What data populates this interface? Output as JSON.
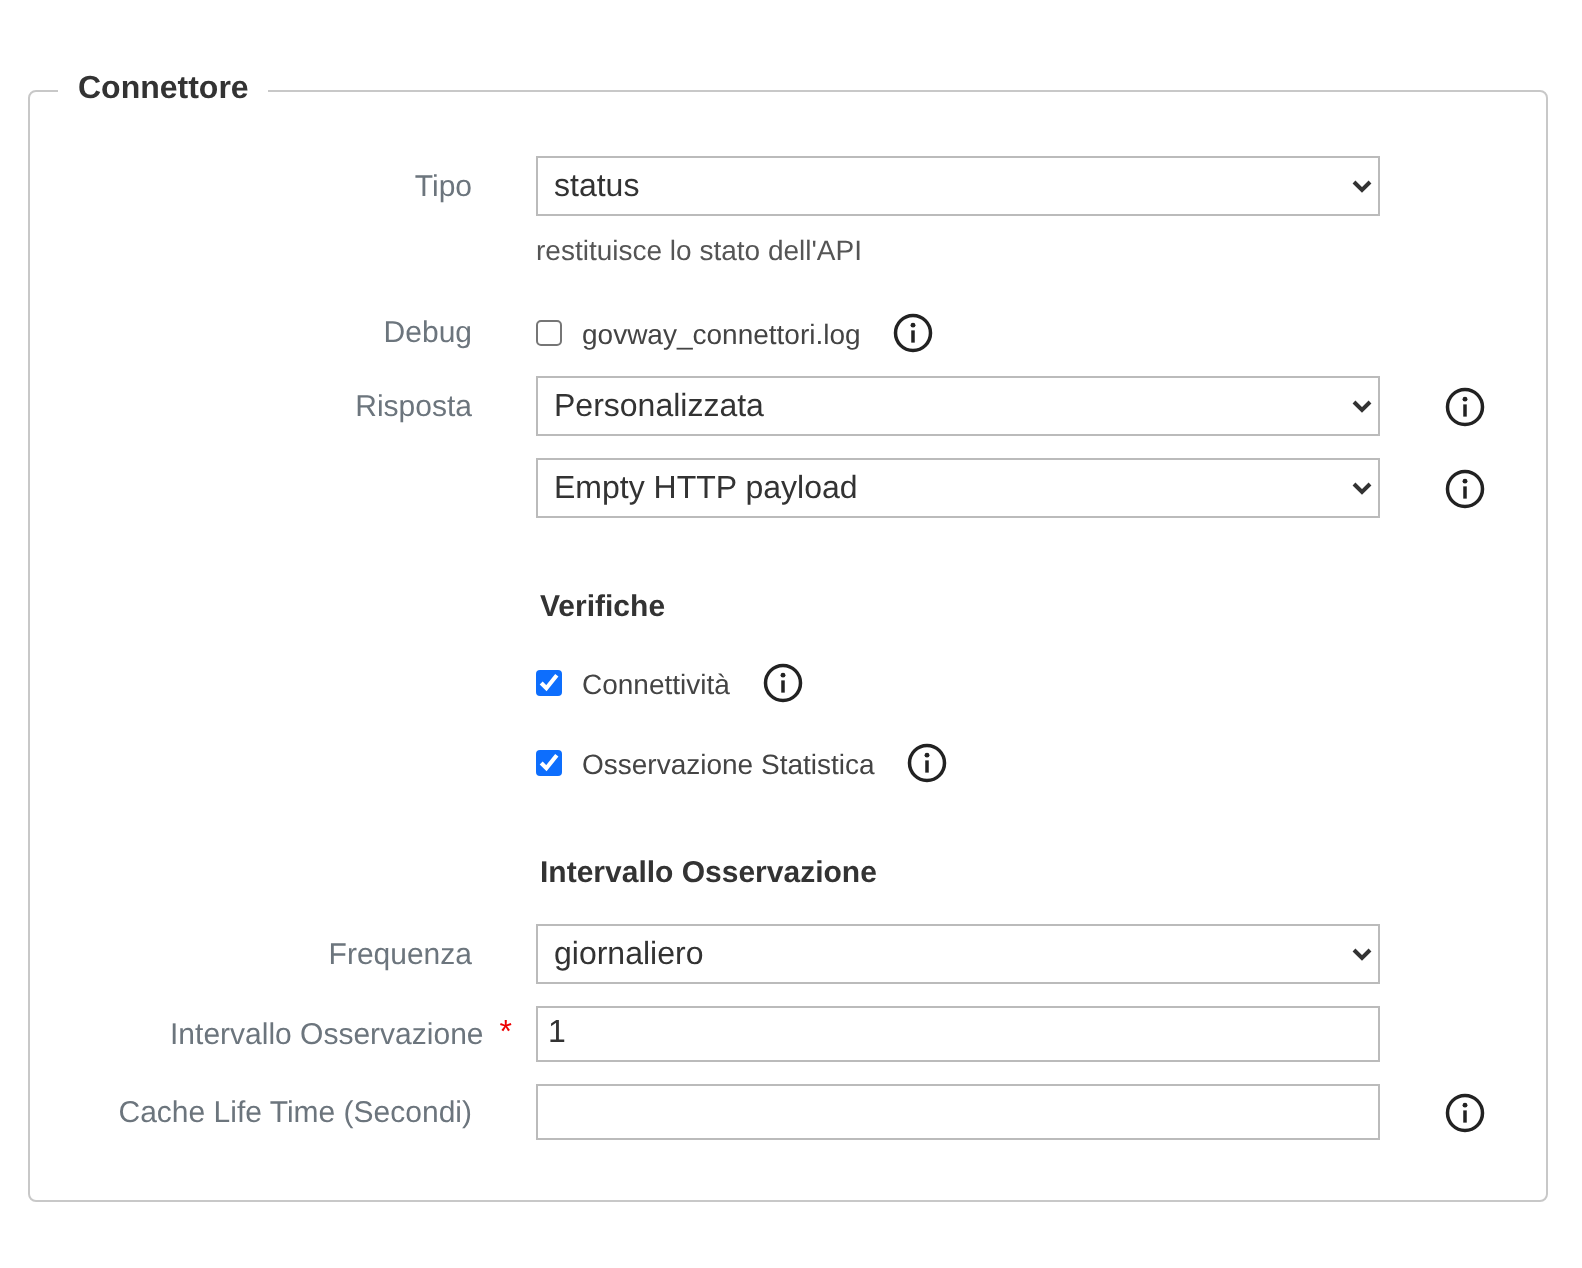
{
  "fieldset": {
    "legend": "Connettore",
    "rows": [
      {
        "kind": "select",
        "label": "Tipo",
        "value": "status",
        "hint": "restituisce lo stato dell'API",
        "info": false
      },
      {
        "kind": "checkbox",
        "label": "Debug",
        "text": "govway_connettori.log",
        "checked": false,
        "info": true
      },
      {
        "kind": "select",
        "label": "Risposta",
        "value": "Personalizzata",
        "info": true
      },
      {
        "kind": "select",
        "value": "Empty HTTP payload",
        "info": true
      },
      {
        "kind": "heading",
        "text": "Verifiche"
      },
      {
        "kind": "checkbox",
        "text": "Connettività",
        "checked": true,
        "info": true
      },
      {
        "kind": "checkbox",
        "text": "Osservazione Statistica",
        "checked": true,
        "info": true
      },
      {
        "kind": "heading",
        "text": "Intervallo Osservazione"
      },
      {
        "kind": "select",
        "label": "Frequenza",
        "value": "giornaliero",
        "info": false
      },
      {
        "kind": "text",
        "label": "Intervallo Osservazione",
        "value": "1",
        "info": false,
        "required_mark": "*"
      },
      {
        "kind": "text",
        "label": "Cache Life Time (Secondi)",
        "info": true
      }
    ]
  }
}
